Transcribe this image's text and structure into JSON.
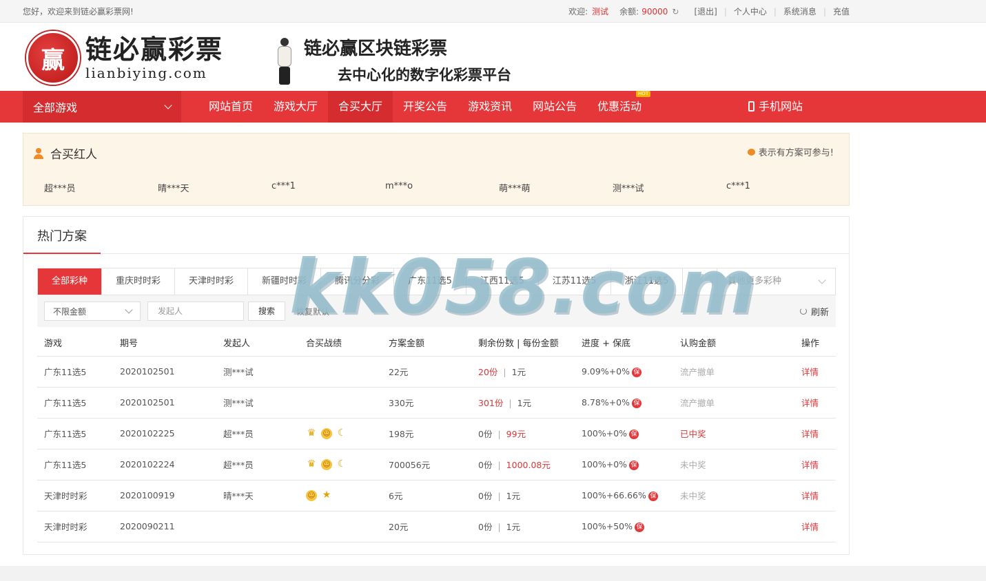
{
  "topbar": {
    "welcome": "您好，欢迎来到链必赢彩票网!",
    "greeting_label": "欢迎:",
    "username": "测试",
    "balance_label": "余额:",
    "balance": "90000",
    "logout": "[退出]",
    "links": [
      "个人中心",
      "系统消息",
      "充值"
    ]
  },
  "logo": {
    "cn": "链必赢彩票",
    "en": "lianbiying.com",
    "emblem": "赢"
  },
  "banner": {
    "line1": "链必赢区块链彩票",
    "line2": "去中心化的数字化彩票平台"
  },
  "nav": {
    "all_games": "全部游戏",
    "items": [
      "网站首页",
      "游戏大厅",
      "合买大厅",
      "开奖公告",
      "游戏资讯",
      "网站公告",
      "优惠活动"
    ],
    "active_index": 2,
    "hot_badge": "HOT",
    "mobile": "手机网站"
  },
  "hero": {
    "title": "合买红人",
    "hint": "表示有方案可参与!",
    "names": [
      "超***员",
      "晴***天",
      "c***1",
      "m***o",
      "萌***萌",
      "测***试",
      "c***1"
    ]
  },
  "panel": {
    "title": "热门方案",
    "tabs": [
      "全部彩种",
      "重庆时时彩",
      "天津时时彩",
      "新疆时时彩",
      "腾讯分分彩",
      "广东11选5",
      "江西11选5",
      "江苏11选5",
      "浙江11选5"
    ],
    "more_select": "其他更多彩种",
    "amount_select": "不限金额",
    "initiator_placeholder": "发起人",
    "search_btn": "搜索",
    "reset": "恢复默认",
    "refresh": "刷新"
  },
  "table": {
    "headers": [
      "游戏",
      "期号",
      "发起人",
      "合买战绩",
      "方案金额",
      "剩余份数 | 每份金额",
      "进度 + 保底",
      "认购金额",
      "操作"
    ],
    "rows": [
      {
        "game": "广东11选5",
        "issue": "2020102501",
        "initiator": "测***试",
        "amount": "22元",
        "remain": "20份",
        "per": "1元",
        "progress": "9.09%+0%",
        "status": "流产撤单",
        "action": "详情"
      },
      {
        "game": "广东11选5",
        "issue": "2020102501",
        "initiator": "测***试",
        "amount": "330元",
        "remain": "301份",
        "per": "1元",
        "progress": "8.78%+0%",
        "status": "流产撤单",
        "action": "详情"
      },
      {
        "game": "广东11选5",
        "issue": "2020102225",
        "initiator": "超***员",
        "amount": "198元",
        "remain": "0份",
        "per": "99元",
        "progress": "100%+0%",
        "status": "已中奖",
        "action": "详情"
      },
      {
        "game": "广东11选5",
        "issue": "2020102224",
        "initiator": "超***员",
        "amount": "700056元",
        "remain": "0份",
        "per": "1000.08元",
        "progress": "100%+0%",
        "status": "未中奖",
        "action": "详情"
      },
      {
        "game": "天津时时彩",
        "issue": "2020100919",
        "initiator": "晴***天",
        "amount": "6元",
        "remain": "0份",
        "per": "1元",
        "progress": "100%+66.66%",
        "status": "未中奖",
        "action": "详情"
      },
      {
        "game": "天津时时彩",
        "issue": "2020090211",
        "initiator": "",
        "amount": "20元",
        "remain": "0份",
        "per": "1元",
        "progress": "100%+50%",
        "status": "",
        "action": "详情"
      }
    ],
    "bao_label": "保"
  },
  "watermark": "kk058.com",
  "colors": {
    "brand_red": "#e5373a",
    "hero_bg": "#fdf6e8",
    "accent_orange": "#f08a24"
  }
}
